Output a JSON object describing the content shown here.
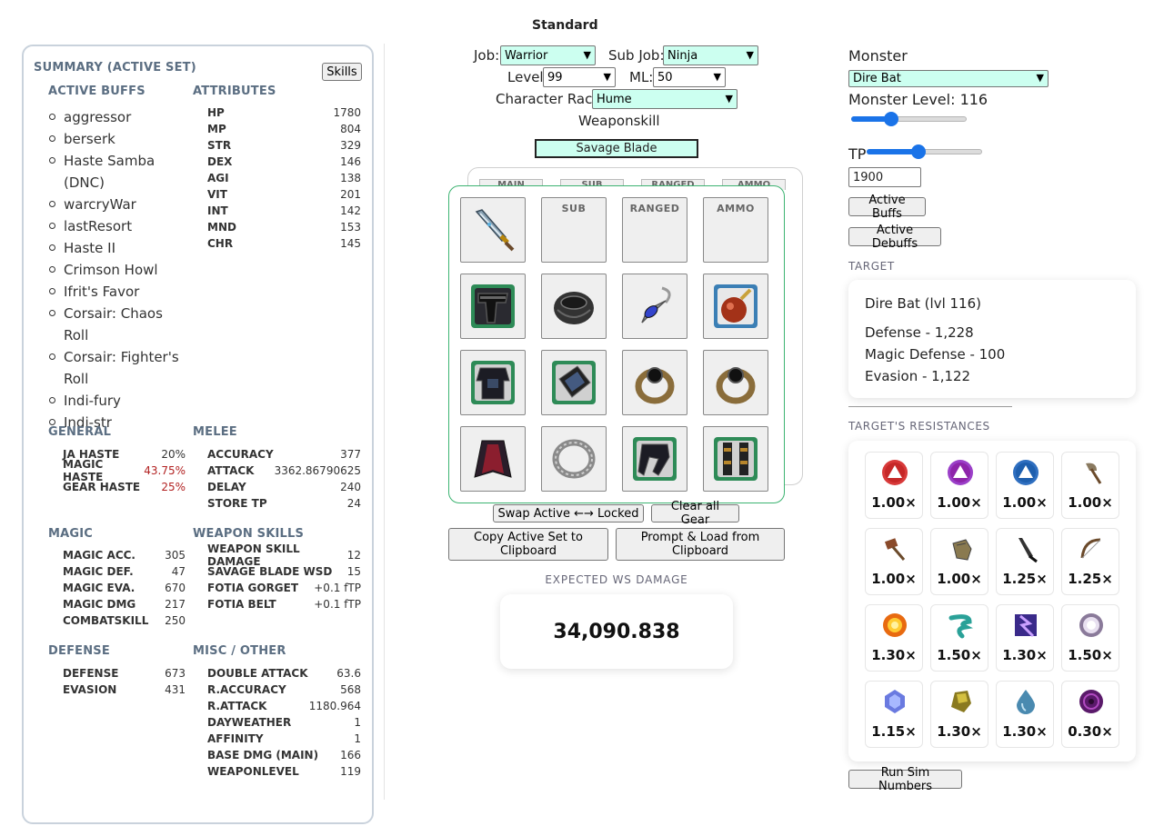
{
  "page": {
    "title": "Standard"
  },
  "summary": {
    "title": "SUMMARY (ACTIVE SET)",
    "skills_button": "Skills",
    "active_buffs_title": "ACTIVE BUFFS",
    "active_buffs": [
      "aggressor",
      "berserk",
      "Haste Samba (DNC)",
      "warcryWar",
      "lastResort",
      "Haste II",
      "Crimson Howl",
      "Ifrit's Favor",
      "Corsair: Chaos Roll",
      "Corsair: Fighter's Roll",
      "Indi-fury",
      "Indi-str"
    ],
    "attributes_title": "ATTRIBUTES",
    "attributes": [
      {
        "k": "HP",
        "v": "1780"
      },
      {
        "k": "MP",
        "v": "804"
      },
      {
        "k": "STR",
        "v": "329"
      },
      {
        "k": "DEX",
        "v": "146"
      },
      {
        "k": "AGI",
        "v": "138"
      },
      {
        "k": "VIT",
        "v": "201"
      },
      {
        "k": "INT",
        "v": "142"
      },
      {
        "k": "MND",
        "v": "153"
      },
      {
        "k": "CHR",
        "v": "145"
      }
    ],
    "general_title": "GENERAL",
    "general": [
      {
        "k": "JA HASTE",
        "v": "20%",
        "red": false
      },
      {
        "k": "MAGIC HASTE",
        "v": "43.75%",
        "red": true
      },
      {
        "k": "GEAR HASTE",
        "v": "25%",
        "red": true
      }
    ],
    "melee_title": "MELEE",
    "melee": [
      {
        "k": "ACCURACY",
        "v": "377"
      },
      {
        "k": "ATTACK",
        "v": "3362.86790625"
      },
      {
        "k": "DELAY",
        "v": "240"
      },
      {
        "k": "STORE TP",
        "v": "24"
      }
    ],
    "magic_title": "MAGIC",
    "magic": [
      {
        "k": "MAGIC ACC.",
        "v": "305"
      },
      {
        "k": "MAGIC DEF.",
        "v": "47"
      },
      {
        "k": "MAGIC EVA.",
        "v": "670"
      },
      {
        "k": "MAGIC DMG",
        "v": "217"
      },
      {
        "k": "COMBATSKILL",
        "v": "250"
      }
    ],
    "ws_title": "WEAPON SKILLS",
    "weapon_skills": [
      {
        "k": "WEAPON SKILL DAMAGE",
        "v": "12"
      },
      {
        "k": "SAVAGE BLADE WSD",
        "v": "15"
      },
      {
        "k": "FOTIA GORGET",
        "v": "+0.1 fTP"
      },
      {
        "k": "FOTIA BELT",
        "v": "+0.1 fTP"
      }
    ],
    "defense_title": "DEFENSE",
    "defense": [
      {
        "k": "DEFENSE",
        "v": "673"
      },
      {
        "k": "EVASION",
        "v": "431"
      }
    ],
    "misc_title": "MISC / OTHER",
    "misc": [
      {
        "k": "DOUBLE ATTACK",
        "v": "63.6"
      },
      {
        "k": "R.ACCURACY",
        "v": "568"
      },
      {
        "k": "R.ATTACK",
        "v": "1180.964"
      },
      {
        "k": "DAYWEATHER",
        "v": "1"
      },
      {
        "k": "AFFINITY",
        "v": "1"
      },
      {
        "k": "BASE DMG (MAIN)",
        "v": "166"
      },
      {
        "k": "WEAPONLEVEL",
        "v": "119"
      }
    ]
  },
  "character": {
    "job_label": "Job:",
    "job_value": "Warrior",
    "subjob_label": "Sub Job:",
    "subjob_value": "Ninja",
    "level_label": "Level:",
    "level_value": "99",
    "ml_label": "ML:",
    "ml_value": "50",
    "race_label": "Character Race",
    "race_value": "Hume",
    "weaponskill_label": "Weaponskill",
    "weaponskill_value": "Savage Blade"
  },
  "gear": {
    "ghost_tabs": [
      "MAIN",
      "SUB",
      "RANGED",
      "AMMO"
    ],
    "slot_labels": {
      "sub": "SUB",
      "ranged": "RANGED",
      "ammo": "AMMO"
    },
    "swap_button": "Swap Active ←→ Locked",
    "clear_button": "Clear all Gear",
    "copy_button": "Copy Active Set to Clipboard",
    "load_button": "Prompt & Load from Clipboard"
  },
  "results": {
    "title": "EXPECTED WS DAMAGE",
    "value": "34,090.838"
  },
  "monster": {
    "label": "Monster",
    "value": "Dire Bat",
    "level_label": "Monster Level: 116",
    "level_fraction": 0.35,
    "tp_label": "TP",
    "tp_fraction": 0.45,
    "tp_value": "1900",
    "active_buffs_button": "Active Buffs",
    "active_debuffs_button": "Active Debuffs"
  },
  "target": {
    "title": "TARGET",
    "name": "Dire Bat (lvl 116)",
    "defense": "Defense - 1,228",
    "magic_defense": "Magic Defense - 100",
    "evasion": "Evasion - 1,122"
  },
  "resistances": {
    "title": "TARGET'S RESISTANCES",
    "items": [
      {
        "icon": "slashing-triangle-red-icon",
        "value": "1.00×"
      },
      {
        "icon": "piercing-triangle-purple-icon",
        "value": "1.00×"
      },
      {
        "icon": "blunt-triangle-blue-icon",
        "value": "1.00×"
      },
      {
        "icon": "axe-icon",
        "value": "1.00×"
      },
      {
        "icon": "hammer-icon",
        "value": "1.00×"
      },
      {
        "icon": "fist-icon",
        "value": "1.00×"
      },
      {
        "icon": "katana-icon",
        "value": "1.25×"
      },
      {
        "icon": "bow-icon",
        "value": "1.25×"
      },
      {
        "icon": "fire-icon",
        "value": "1.30×"
      },
      {
        "icon": "wind-icon",
        "value": "1.50×"
      },
      {
        "icon": "thunder-icon",
        "value": "1.30×"
      },
      {
        "icon": "light-icon",
        "value": "1.50×"
      },
      {
        "icon": "ice-icon",
        "value": "1.15×"
      },
      {
        "icon": "earth-icon",
        "value": "1.30×"
      },
      {
        "icon": "water-icon",
        "value": "1.30×"
      },
      {
        "icon": "dark-icon",
        "value": "0.30×"
      }
    ]
  },
  "run_button": "Run Sim Numbers"
}
